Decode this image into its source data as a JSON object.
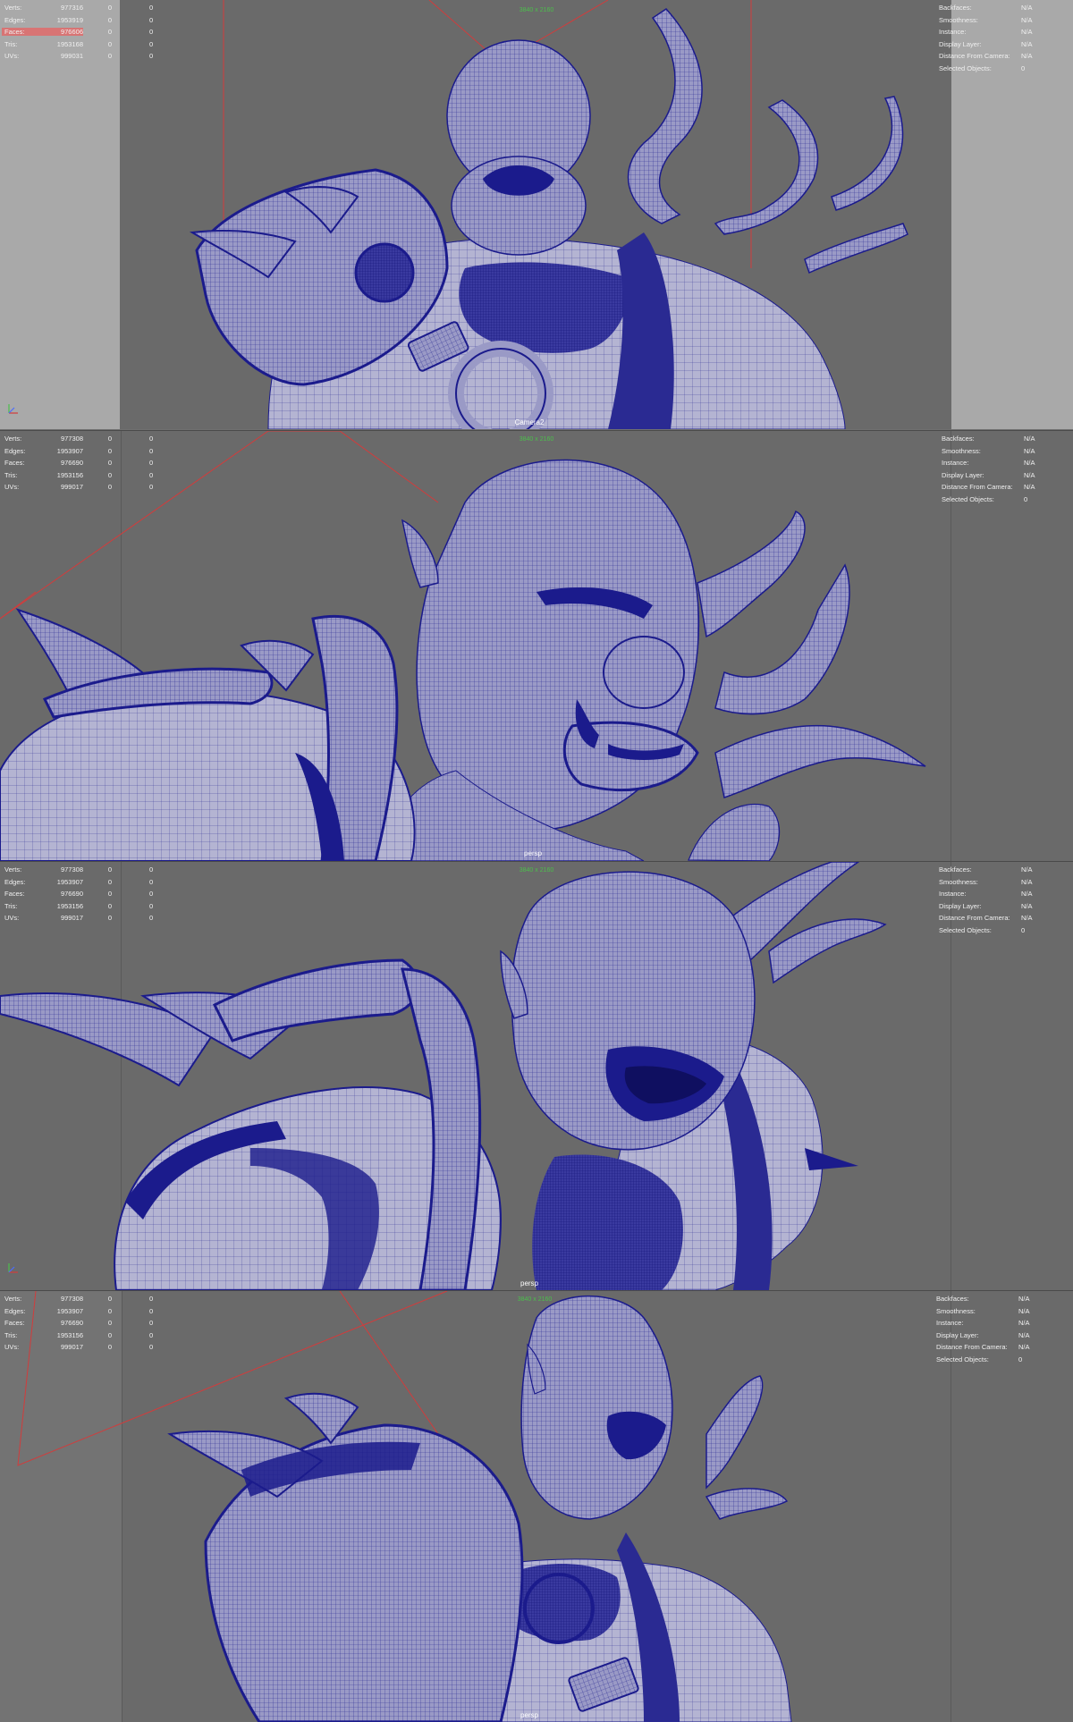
{
  "stat_labels": [
    "Verts:",
    "Edges:",
    "Faces:",
    "Tris:",
    "UVs:"
  ],
  "info_labels": [
    "Backfaces:",
    "Smoothness:",
    "Instance:",
    "Display Layer:",
    "Distance From Camera:",
    "Selected Objects:"
  ],
  "panels": [
    {
      "camera": "Camera2",
      "resolution": "3840 x 2160",
      "highlight_row": 2,
      "stats": [
        {
          "v1": "977316",
          "v2": "0",
          "v3": "0"
        },
        {
          "v1": "1953919",
          "v2": "0",
          "v3": "0"
        },
        {
          "v1": "976606",
          "v2": "0",
          "v3": "0"
        },
        {
          "v1": "1953168",
          "v2": "0",
          "v3": "0"
        },
        {
          "v1": "999031",
          "v2": "0",
          "v3": "0"
        }
      ],
      "info": [
        "N/A",
        "N/A",
        "N/A",
        "N/A",
        "N/A",
        "0"
      ]
    },
    {
      "camera": "persp",
      "resolution": "3840 x 2160",
      "highlight_row": -1,
      "stats": [
        {
          "v1": "977308",
          "v2": "0",
          "v3": "0"
        },
        {
          "v1": "1953907",
          "v2": "0",
          "v3": "0"
        },
        {
          "v1": "976690",
          "v2": "0",
          "v3": "0"
        },
        {
          "v1": "1953156",
          "v2": "0",
          "v3": "0"
        },
        {
          "v1": "999017",
          "v2": "0",
          "v3": "0"
        }
      ],
      "info": [
        "N/A",
        "N/A",
        "N/A",
        "N/A",
        "N/A",
        "0"
      ]
    },
    {
      "camera": "persp",
      "resolution": "3840 x 2160",
      "highlight_row": -1,
      "stats": [
        {
          "v1": "977308",
          "v2": "0",
          "v3": "0"
        },
        {
          "v1": "1953907",
          "v2": "0",
          "v3": "0"
        },
        {
          "v1": "976690",
          "v2": "0",
          "v3": "0"
        },
        {
          "v1": "1953156",
          "v2": "0",
          "v3": "0"
        },
        {
          "v1": "999017",
          "v2": "0",
          "v3": "0"
        }
      ],
      "info": [
        "N/A",
        "N/A",
        "N/A",
        "N/A",
        "N/A",
        "0"
      ]
    },
    {
      "camera": "persp",
      "resolution": "3840 x 2160",
      "highlight_row": -1,
      "stats": [
        {
          "v1": "977308",
          "v2": "0",
          "v3": "0"
        },
        {
          "v1": "1953907",
          "v2": "0",
          "v3": "0"
        },
        {
          "v1": "976690",
          "v2": "0",
          "v3": "0"
        },
        {
          "v1": "1953156",
          "v2": "0",
          "v3": "0"
        },
        {
          "v1": "999017",
          "v2": "0",
          "v3": "0"
        }
      ],
      "info": [
        "N/A",
        "N/A",
        "N/A",
        "N/A",
        "N/A",
        "0"
      ]
    }
  ],
  "colors": {
    "viewport_bg": "#6a6a6a",
    "gate_bg": "#a9a9a9",
    "wire": "#1b1b8c",
    "surface": "#8f8fc0",
    "highlight": "#d87474",
    "resolution_text": "#4cbf4c",
    "camera_frustum": "#d23c3c"
  }
}
